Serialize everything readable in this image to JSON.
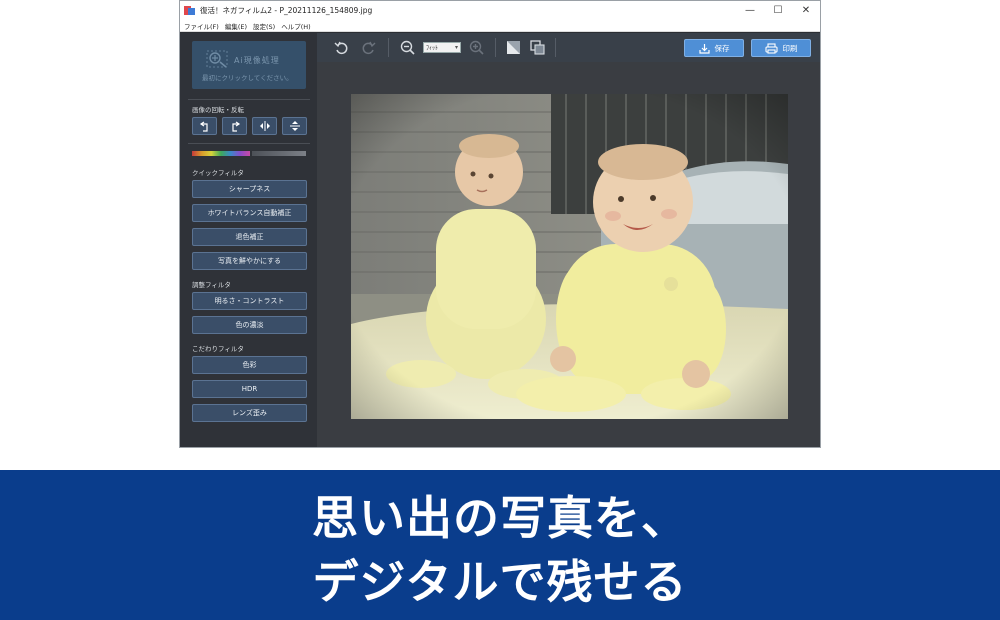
{
  "window": {
    "title": "復活！ネガフィルム2 - P_20211126_154809.jpg",
    "minimize_glyph": "—",
    "maximize_glyph": "☐",
    "close_glyph": "✕"
  },
  "menu": [
    "ファイル(F)",
    "編集(E)",
    "設定(S)",
    "ヘルプ(H)"
  ],
  "sidebar": {
    "ai_box": {
      "title": "Ai現像処理",
      "subtitle": "最初にクリックしてください。"
    },
    "rotate_heading": "画像の回転・反転",
    "quick_filter_heading": "クイックフィルタ",
    "quick_filters": [
      "シャープネス",
      "ホワイトバランス自動補正",
      "退色補正",
      "写真を鮮やかにする"
    ],
    "adjust_filter_heading": "調整フィルタ",
    "adjust_filters": [
      "明るさ・コントラスト",
      "色の濃淡"
    ],
    "special_filter_heading": "こだわりフィルタ",
    "special_filters": [
      "色彩",
      "HDR",
      "レンズ歪み"
    ]
  },
  "toolbar": {
    "zoom_value": "ﾌｨｯﾄ",
    "save_label": "保存",
    "print_label": "印刷"
  },
  "banner": {
    "line1": "思い出の写真を、",
    "line2": "デジタルで残せる"
  },
  "colors": {
    "accent_button": "#4f8fd6",
    "banner_background": "#0a3d8c",
    "filter_button": "#3a4e68"
  }
}
